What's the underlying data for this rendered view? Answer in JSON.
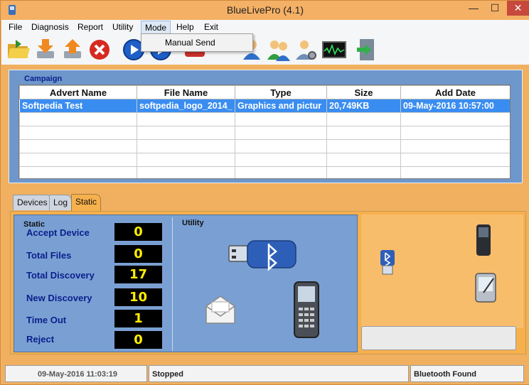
{
  "window": {
    "title": "BlueLivePro (4.1)",
    "controls": {
      "minimize": "—",
      "maximize": "☐",
      "close": "✕"
    }
  },
  "menubar": {
    "items": [
      "File",
      "Diagnosis",
      "Report",
      "Utility",
      "Mode",
      "Help",
      "Exit"
    ],
    "open_menu": "Mode",
    "dropdown_items": [
      "Manual Send"
    ]
  },
  "toolbar": {
    "buttons": [
      "folder-open-icon",
      "download-icon",
      "upload-icon",
      "stop-icon",
      "play-icon",
      "play-icon",
      "send-icon",
      "user-icon",
      "users-icon",
      "user-settings-icon",
      "signal-monitor-icon",
      "exit-door-icon"
    ]
  },
  "campaign": {
    "label": "Campaign",
    "columns": [
      "Advert Name",
      "File Name",
      "Type",
      "Size",
      "Add Date"
    ],
    "rows": [
      [
        "Softpedia Test",
        "softpedia_logo_2014_",
        "Graphics and pictur",
        "20,749KB",
        "09-May-2016 10:57:00"
      ]
    ]
  },
  "tabs": [
    "Devices",
    "Log",
    "Static"
  ],
  "active_tab": "Static",
  "static_panel": {
    "label": "Static",
    "stats": [
      {
        "label": "Accept Device",
        "value": "0"
      },
      {
        "label": "Total Files",
        "value": "0"
      },
      {
        "label": "Total Discovery",
        "value": "17"
      },
      {
        "label": "New Discovery",
        "value": "10"
      },
      {
        "label": "Time Out",
        "value": "1"
      },
      {
        "label": "Reject",
        "value": "0"
      }
    ]
  },
  "utility_panel": {
    "label": "Utility"
  },
  "statusbar": {
    "datetime": "09-May-2016 11:03:19",
    "status": "Stopped",
    "bluetooth": "Bluetooth Found"
  },
  "colors": {
    "frame": "#f4b065",
    "campaign_panel": "#6e97cc",
    "selection": "#3a8df0",
    "stat_value_text": "#ffee00"
  }
}
